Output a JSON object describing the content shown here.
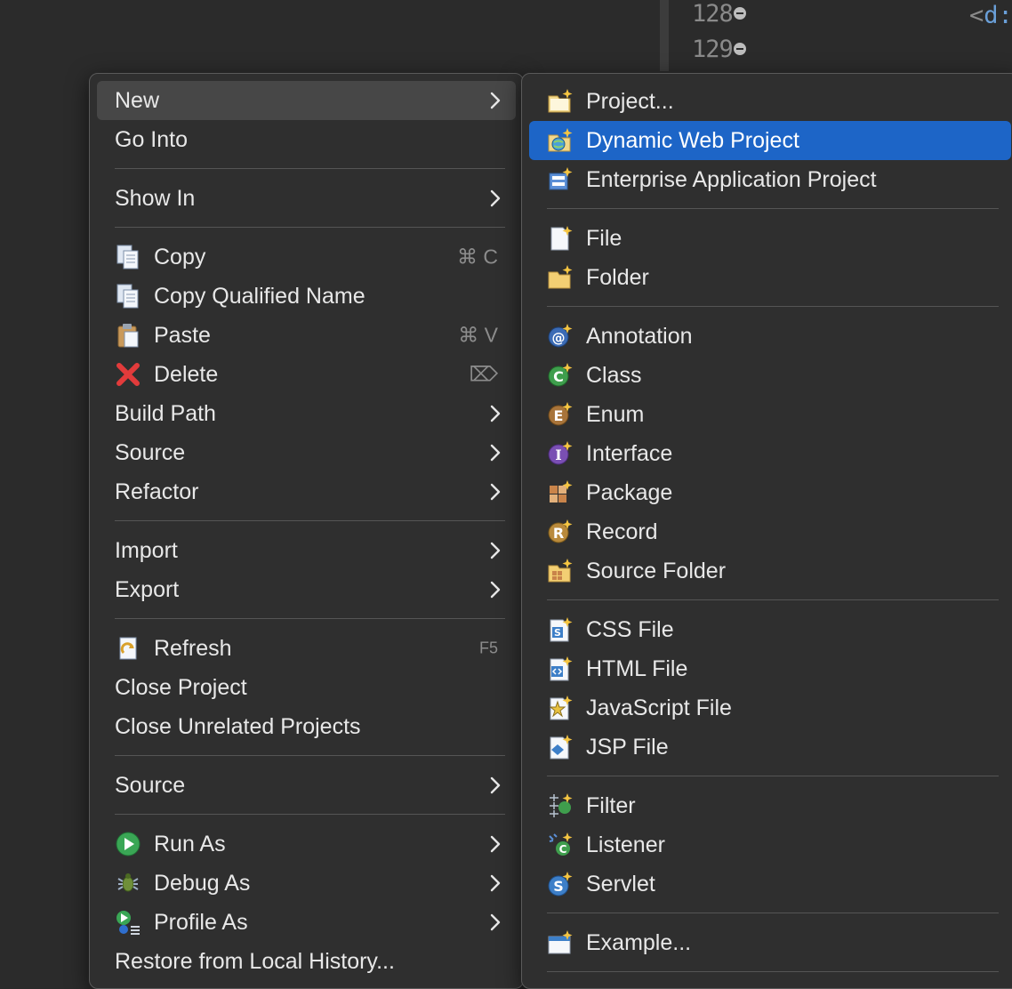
{
  "editor": {
    "line_128": "128",
    "line_129": "129",
    "code_fragment_bracket": "<",
    "code_fragment_tag": "d:"
  },
  "main_menu": {
    "new": "New",
    "go_into": "Go Into",
    "show_in": "Show In",
    "copy": "Copy",
    "copy_shortcut": "⌘ C",
    "copy_qualified_name": "Copy Qualified Name",
    "paste": "Paste",
    "paste_shortcut": "⌘ V",
    "delete": "Delete",
    "delete_shortcut": "⌦",
    "build_path": "Build Path",
    "source": "Source",
    "refactor": "Refactor",
    "import": "Import",
    "export": "Export",
    "refresh": "Refresh",
    "refresh_shortcut": "F5",
    "close_project": "Close Project",
    "close_unrelated_projects": "Close Unrelated Projects",
    "source_2": "Source",
    "run_as": "Run As",
    "debug_as": "Debug As",
    "profile_as": "Profile As",
    "restore_from_local_history": "Restore from Local History..."
  },
  "new_submenu": {
    "project": "Project...",
    "dynamic_web_project": "Dynamic Web Project",
    "enterprise_application_project": "Enterprise Application Project",
    "file": "File",
    "folder": "Folder",
    "annotation": "Annotation",
    "class": "Class",
    "enum": "Enum",
    "interface": "Interface",
    "package": "Package",
    "record": "Record",
    "source_folder": "Source Folder",
    "css_file": "CSS File",
    "html_file": "HTML File",
    "javascript_file": "JavaScript File",
    "jsp_file": "JSP File",
    "filter": "Filter",
    "listener": "Listener",
    "servlet": "Servlet",
    "example": "Example..."
  },
  "colors": {
    "menu_bg": "#2f2f2f",
    "selection": "#1d65c7",
    "hover": "#474747"
  }
}
